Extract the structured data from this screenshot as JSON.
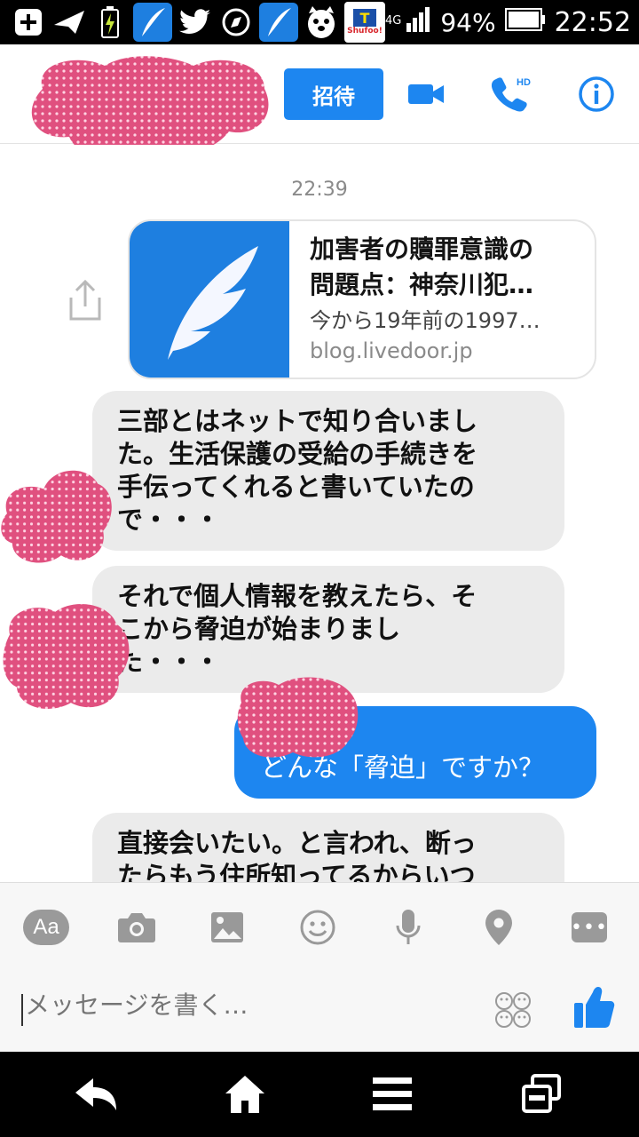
{
  "status_bar": {
    "network": "4G",
    "battery": "94%",
    "time": "22:52",
    "shufoo_label": "Shufoo!"
  },
  "header": {
    "invite_label": "招待"
  },
  "chat": {
    "timestamp": "22:39",
    "link_card": {
      "title_line1": "加害者の贖罪意識の",
      "title_line2": "問題点：神奈川犯…",
      "description": "今から19年前の1997…",
      "domain": "blog.livedoor.jp"
    },
    "messages": [
      {
        "direction": "incoming",
        "lines": [
          "三部とはネットで知り合いまし",
          "た。生活保護の受給の手続きを",
          "手伝ってくれると書いていたの",
          "で・・・"
        ]
      },
      {
        "direction": "incoming",
        "lines": [
          "それで個人情報を教えたら、そ",
          "こから脅迫が始まりまし",
          "た・・・"
        ]
      },
      {
        "direction": "outgoing",
        "lines": [
          "どんな「脅迫」ですか？"
        ]
      },
      {
        "direction": "incoming",
        "lines": [
          "直接会いたい。と言われ、断っ",
          "たらもう住所知ってるからいつ"
        ]
      }
    ]
  },
  "composer": {
    "aa_label": "Aa",
    "placeholder": "メッセージを書く…",
    "tools": [
      "text-format-icon",
      "camera-icon",
      "image-icon",
      "emoji-icon",
      "microphone-icon",
      "location-icon",
      "more-icon"
    ]
  },
  "colors": {
    "accent": "#1d86f0",
    "bubble_in": "#ebebeb",
    "redaction": "#e0507f"
  }
}
